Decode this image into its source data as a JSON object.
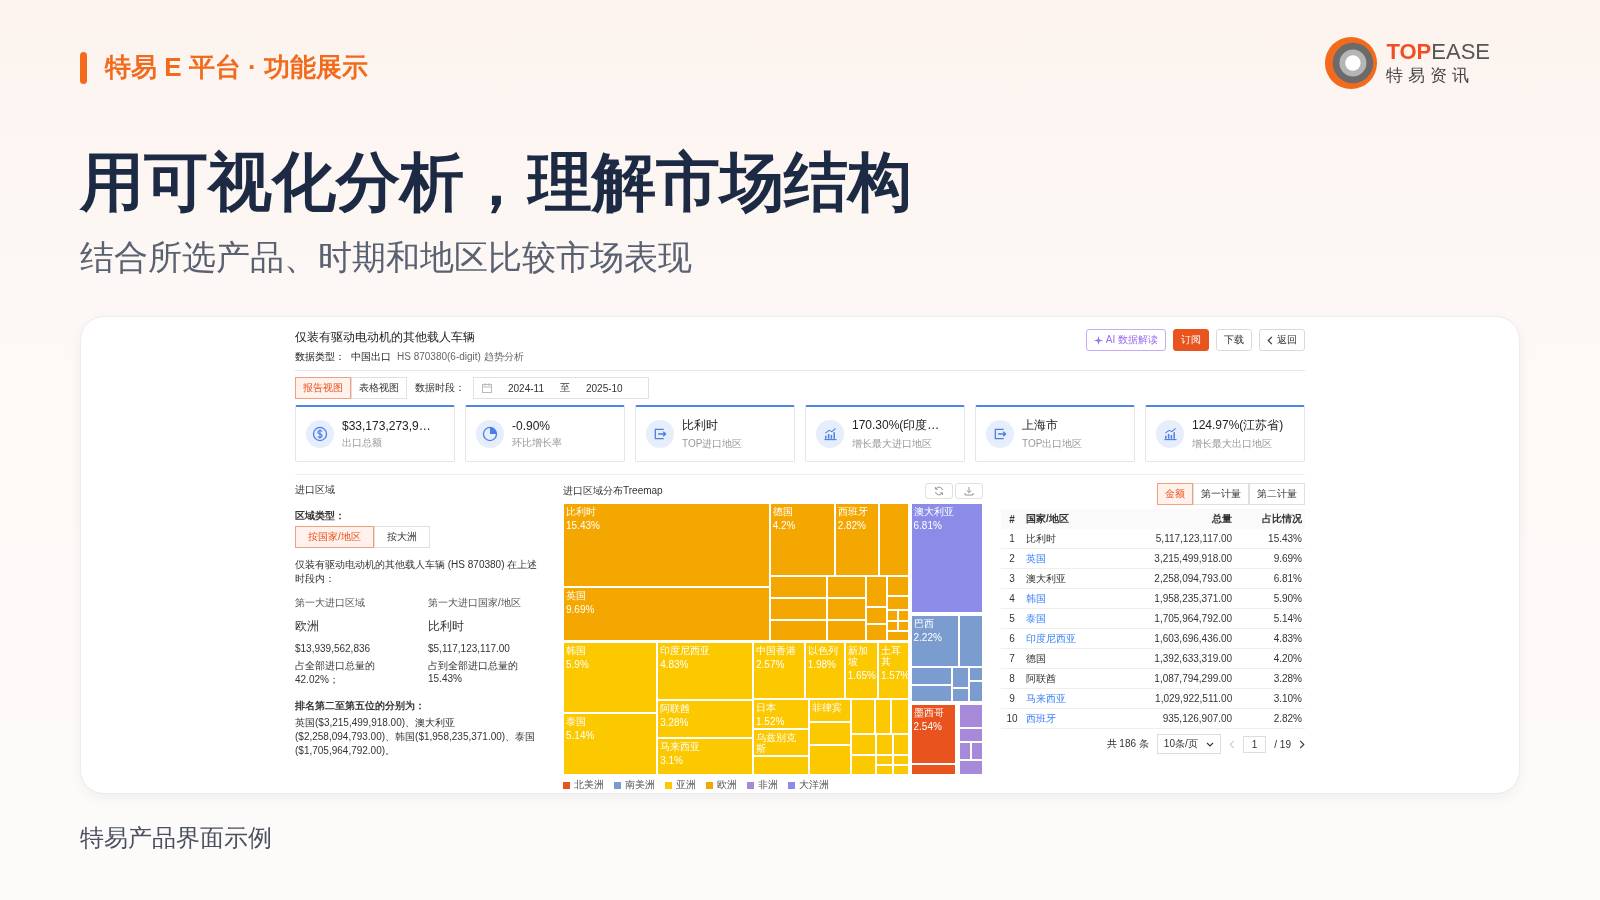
{
  "slide": {
    "tag": "特易 E 平台 · 功能展示",
    "logo": {
      "accent": "TOP",
      "rest": "EASE",
      "subtitle": "特易资讯"
    },
    "title": "用可视化分析，理解市场结构",
    "subtitle": "结合所选产品、时期和地区比较市场表现",
    "caption": "特易产品界面示例"
  },
  "app": {
    "title": "仅装有驱动电动机的其他载人车辆",
    "meta_label": "数据类型：",
    "meta_value": "中国出口",
    "meta_hs": "HS 870380(6-digit) 趋势分析",
    "actions": [
      {
        "kind": "ai",
        "label": "AI 数据解读"
      },
      {
        "kind": "primary",
        "label": "订阅"
      },
      {
        "kind": "plain",
        "label": "下载"
      },
      {
        "kind": "back",
        "label": "返回"
      }
    ],
    "views": [
      {
        "label": "报告视图",
        "selected": true
      },
      {
        "label": "表格视图",
        "selected": false
      }
    ],
    "period": {
      "label": "数据时段：",
      "start": "2024-11",
      "sep": "至",
      "end": "2025-10"
    },
    "kpis": [
      {
        "kind": "amount",
        "value": "$33,173,273,9…",
        "label": "出口总额"
      },
      {
        "kind": "growth",
        "value": "-0.90%",
        "label": "环比增长率"
      },
      {
        "kind": "region",
        "value": "比利时",
        "label": "TOP进口地区"
      },
      {
        "kind": "trend",
        "value": "170.30%(印度…",
        "label": "增长最大进口地区"
      },
      {
        "kind": "region",
        "value": "上海市",
        "label": "TOP出口地区"
      },
      {
        "kind": "trend",
        "value": "124.97%(江苏省)",
        "label": "增长最大出口地区"
      }
    ],
    "region": {
      "heading": "进口区域",
      "type_label": "区域类型：",
      "modes": [
        {
          "label": "按国家/地区",
          "selected": true
        },
        {
          "label": "按大洲",
          "selected": false
        }
      ],
      "summary": "仅装有驱动电动机的其他载人车辆 (HS 870380) 在上述时段内：",
      "stats": [
        {
          "label": "第一大进口区域",
          "name": "欧洲",
          "amount": "$13,939,562,836",
          "share": "占全部进口总量的42.02%；"
        },
        {
          "label": "第一大进口国家/地区",
          "name": "比利时",
          "amount": "$5,117,123,117.00",
          "share": "占到全部进口总量的15.43%"
        }
      ],
      "ranking_heading": "排名第二至第五位的分别为：",
      "ranking": "英国($3,215,499,918.00)、澳大利亚($2,258,094,793.00)、韩国($1,958,235,371.00)、泰国($1,705,964,792.00)。"
    },
    "treemap": {
      "title": "进口区域分布Treemap",
      "tiles": [
        {
          "label": "比利时",
          "value": "15.43%",
          "color": "#f4a700"
        },
        {
          "label": "英国",
          "value": "9.69%",
          "color": "#f4a700"
        },
        {
          "label": "德国",
          "value": "4.2%",
          "color": "#f4a700"
        },
        {
          "label": "西班牙",
          "value": "2.82%",
          "color": "#f4a700"
        },
        {
          "label": "韩国",
          "value": "5.9%",
          "color": "#fcc800"
        },
        {
          "label": "泰国",
          "value": "5.14%",
          "color": "#fcc800"
        },
        {
          "label": "印度尼西亚",
          "value": "4.83%",
          "color": "#fcc800"
        },
        {
          "label": "阿联酋",
          "value": "3.28%",
          "color": "#fcc800"
        },
        {
          "label": "马来西亚",
          "value": "3.1%",
          "color": "#fcc800"
        },
        {
          "label": "中国香港",
          "value": "2.57%",
          "color": "#fcc800"
        },
        {
          "label": "以色列",
          "value": "1.98%",
          "color": "#fcc800"
        },
        {
          "label": "新加坡",
          "value": "1.65%",
          "color": "#fcc800"
        },
        {
          "label": "土耳其",
          "value": "1.57%",
          "color": "#fcc800"
        },
        {
          "label": "日本",
          "value": "1.52%",
          "color": "#fcc800"
        },
        {
          "label": "乌兹别克斯",
          "color": "#fcc800"
        },
        {
          "label": "菲律宾",
          "color": "#fcc800"
        },
        {
          "label": "澳大利亚",
          "value": "6.81%",
          "color": "#8b8be8"
        },
        {
          "label": "巴西",
          "value": "2.22%",
          "color": "#7a9ccf"
        },
        {
          "label": "墨西哥",
          "value": "2.54%",
          "color": "#e8531e"
        }
      ],
      "legend": [
        {
          "label": "北美洲",
          "color": "#e8531e"
        },
        {
          "label": "南美洲",
          "color": "#7a9ccf"
        },
        {
          "label": "亚洲",
          "color": "#fcc800"
        },
        {
          "label": "欧洲",
          "color": "#f4a700"
        },
        {
          "label": "非洲",
          "color": "#a68ad9"
        },
        {
          "label": "大洋洲",
          "color": "#8b8be8"
        }
      ]
    },
    "table": {
      "measures": [
        {
          "label": "金额",
          "selected": true
        },
        {
          "label": "第一计量",
          "selected": false
        },
        {
          "label": "第二计量",
          "selected": false
        }
      ],
      "columns": [
        "#",
        "国家/地区",
        "总量",
        "占比情况"
      ],
      "rows": [
        {
          "rank": "1",
          "name": "比利时",
          "link": false,
          "total": "5,117,123,117.00",
          "share": "15.43%"
        },
        {
          "rank": "2",
          "name": "英国",
          "link": true,
          "total": "3,215,499,918.00",
          "share": "9.69%"
        },
        {
          "rank": "3",
          "name": "澳大利亚",
          "link": false,
          "total": "2,258,094,793.00",
          "share": "6.81%"
        },
        {
          "rank": "4",
          "name": "韩国",
          "link": true,
          "total": "1,958,235,371.00",
          "share": "5.90%"
        },
        {
          "rank": "5",
          "name": "泰国",
          "link": true,
          "total": "1,705,964,792.00",
          "share": "5.14%"
        },
        {
          "rank": "6",
          "name": "印度尼西亚",
          "link": true,
          "total": "1,603,696,436.00",
          "share": "4.83%"
        },
        {
          "rank": "7",
          "name": "德国",
          "link": false,
          "total": "1,392,633,319.00",
          "share": "4.20%"
        },
        {
          "rank": "8",
          "name": "阿联酋",
          "link": false,
          "total": "1,087,794,299.00",
          "share": "3.28%"
        },
        {
          "rank": "9",
          "name": "马来西亚",
          "link": true,
          "total": "1,029,922,511.00",
          "share": "3.10%"
        },
        {
          "rank": "10",
          "name": "西班牙",
          "link": true,
          "total": "935,126,907.00",
          "share": "2.82%"
        }
      ],
      "pager": {
        "total": "共 186 条",
        "size": "10条/页",
        "page": "1",
        "pages": "/ 19"
      }
    }
  }
}
